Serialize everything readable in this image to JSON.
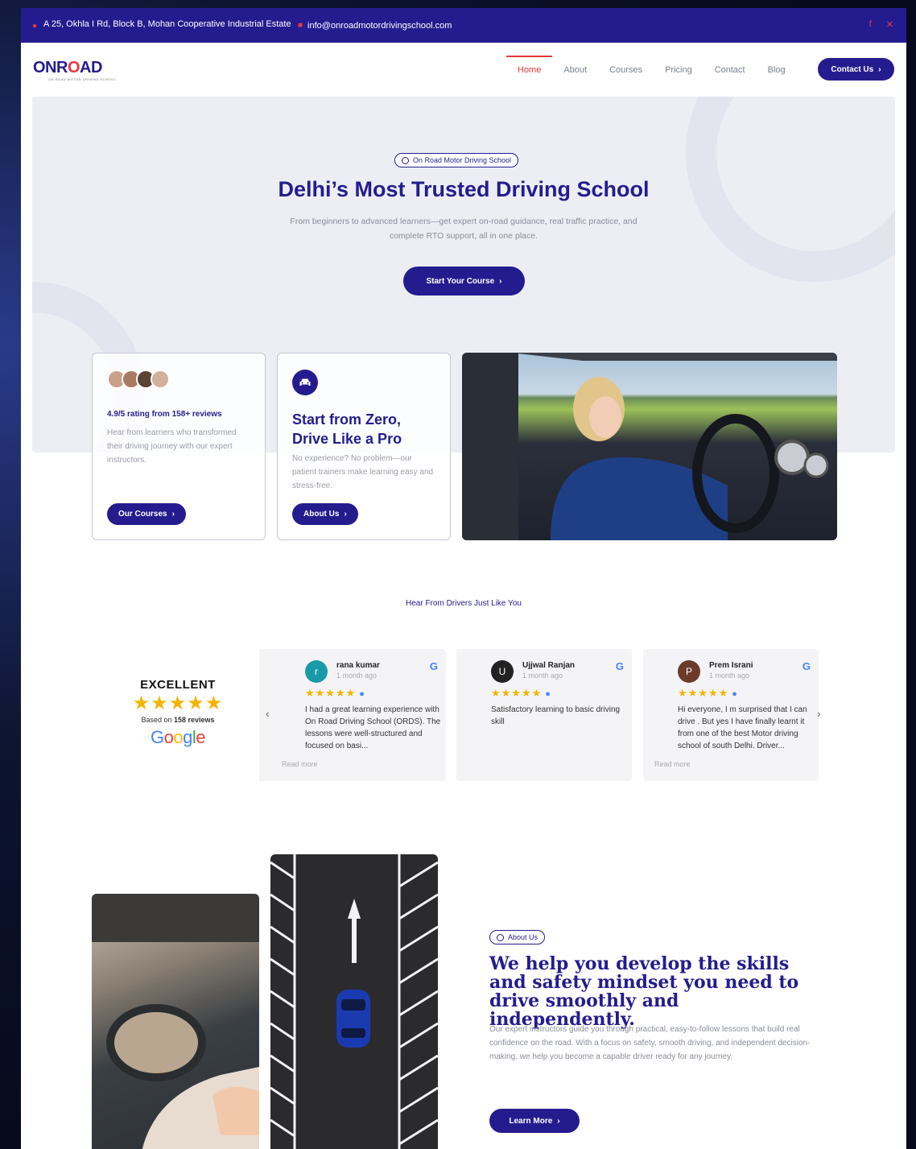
{
  "topbar": {
    "address": "A 25, Okhla I Rd, Block B, Mohan Cooperative Industrial Estate",
    "email": "info@onroadmotordrivingschool.com",
    "social": [
      "f",
      "✕"
    ]
  },
  "header": {
    "logo_prefix": "ONR",
    "logo_mid": "O",
    "logo_suffix": "AD",
    "logo_tagline": "ON ROAD MOTOR DRIVING SCHOOL",
    "nav": [
      "Home",
      "About",
      "Courses",
      "Pricing",
      "Contact",
      "Blog"
    ],
    "cta": "Contact Us"
  },
  "hero": {
    "badge": "On Road Motor Driving School",
    "title": "Delhi’s Most Trusted Driving School",
    "description": "From beginners to advanced learners—get expert on-road guidance, real traffic practice, and complete RTO support, all in one place.",
    "button": "Start Your Course"
  },
  "cards": {
    "rating_title": "4.9/5 rating from 158+ reviews",
    "rating_desc": "Hear from learners who transformed their driving journey with our expert instructors.",
    "courses_btn": "Our Courses",
    "zero_title": "Start from Zero, Drive Like a Pro",
    "zero_desc": "No experience? No problem—our patient trainers make learning easy and stress-free.",
    "about_btn": "About Us"
  },
  "reviews": {
    "section_title": "Hear From Drivers Just Like You",
    "summary": {
      "label": "EXCELLENT",
      "stars": "★★★★★",
      "based_prefix": "Based on",
      "based_count": "158 reviews",
      "brand": "Google"
    },
    "items": [
      {
        "initial": "r",
        "avatar_color": "#1a9aa8",
        "name": "rana kumar",
        "ago": "1 month ago",
        "stars": "★★★★★",
        "text": "I had a great learning experience with On Road Driving School (ORDS). The lessons were well-structured and focused on basi...",
        "more": "Read more"
      },
      {
        "initial": "U",
        "avatar_color": "#222222",
        "name": "Ujjwal Ranjan",
        "ago": "1 month ago",
        "stars": "★★★★★",
        "text": "Satisfactory learning to basic driving skill",
        "more": ""
      },
      {
        "initial": "P",
        "avatar_color": "#6b3a2a",
        "name": "Prem Israni",
        "ago": "1 month ago",
        "stars": "★★★★★",
        "text": "Hi everyone, I m surprised that I can drive . But yes I have finally learnt it from one of the best Motor driving school of south Delhi. Driver...",
        "more": "Read more"
      }
    ]
  },
  "about": {
    "badge": "About Us",
    "title": "We help you develop the skills and safety mindset you need to drive smoothly and independently.",
    "description": "Our expert instructors guide you through practical, easy-to-follow lessons that build real confidence on the road. With a focus on safety, smooth driving, and independent decision-making, we help you become a capable driver ready for any journey.",
    "button": "Learn More"
  },
  "colors": {
    "brand": "#241c8e",
    "accent": "#e8383d",
    "star": "#f5b400"
  }
}
